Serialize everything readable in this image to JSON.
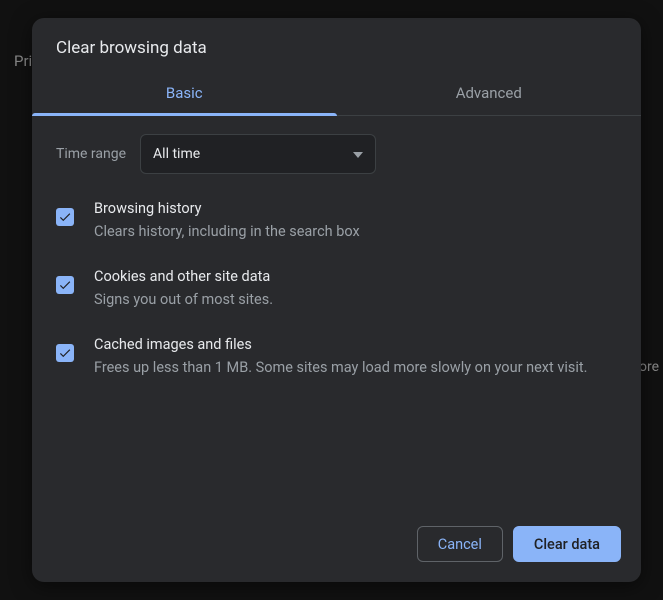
{
  "backdrop": {
    "left_text": "Priv",
    "right_text": "more"
  },
  "dialog": {
    "title": "Clear browsing data",
    "tabs": {
      "basic": "Basic",
      "advanced": "Advanced"
    },
    "time_range": {
      "label": "Time range",
      "value": "All time"
    },
    "options": [
      {
        "title": "Browsing history",
        "desc": "Clears history, including in the search box",
        "checked": true
      },
      {
        "title": "Cookies and other site data",
        "desc": "Signs you out of most sites.",
        "checked": true
      },
      {
        "title": "Cached images and files",
        "desc": "Frees up less than 1 MB. Some sites may load more slowly on your next visit.",
        "checked": true
      }
    ],
    "buttons": {
      "cancel": "Cancel",
      "confirm": "Clear data"
    }
  }
}
